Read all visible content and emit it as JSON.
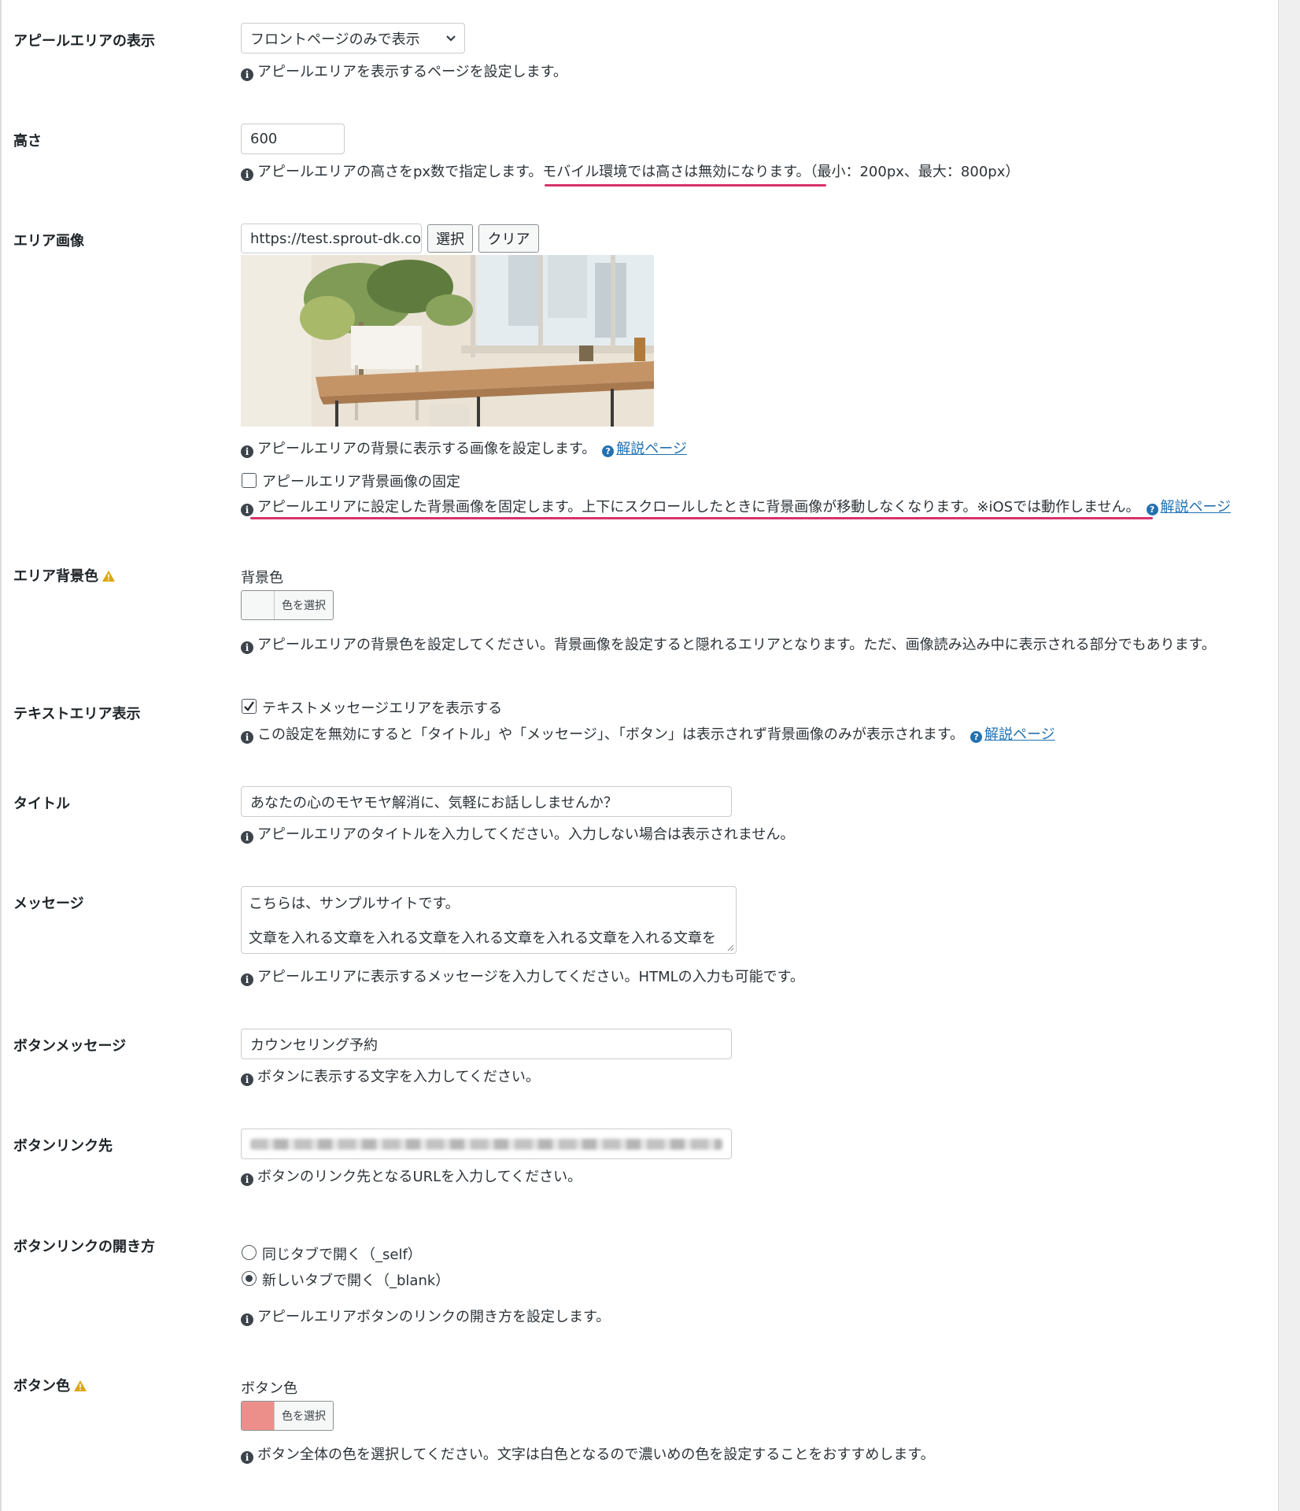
{
  "colors": {
    "accent": "#2271b1",
    "underline": "#d6336c",
    "button_color": "#ec8f8b",
    "warning": "#dba617"
  },
  "rows": {
    "display": {
      "label": "アピールエリアの表示",
      "select_value": "フロントページのみで表示",
      "desc": "アピールエリアを表示するページを設定します。"
    },
    "height": {
      "label": "高さ",
      "value": "600",
      "desc_a": "アピールエリアの高さをpx数で指定します。",
      "desc_b": "モバイル環境では高さは無効になります。",
      "desc_c": "（最小：200px、最大：800px）"
    },
    "image": {
      "label": "エリア画像",
      "url_value": "https://test.sprout-dk.co",
      "select_button": "選択",
      "clear_button": "クリア",
      "desc": "アピールエリアの背景に表示する画像を設定します。",
      "help_link": "解説ページ",
      "fixed_label": "アピールエリア背景画像の固定",
      "fixed_desc": "アピールエリアに設定した背景画像を固定します。上下にスクロールしたときに背景画像が移動しなくなります。※iOSでは動作しません。",
      "fixed_help_link": "解説ページ"
    },
    "bgcolor": {
      "label": "エリア背景色",
      "sub_label": "背景色",
      "picker_label": "色を選択",
      "desc": "アピールエリアの背景色を設定してください。背景画像を設定すると隠れるエリアとなります。ただ、画像読み込み中に表示される部分でもあります。"
    },
    "textarea_display": {
      "label": "テキストエリア表示",
      "checkbox_label": "テキストメッセージエリアを表示する",
      "desc": "この設定を無効にすると「タイトル」や「メッセージ」、「ボタン」は表示されず背景画像のみが表示されます。",
      "help_link": "解説ページ"
    },
    "title": {
      "label": "タイトル",
      "value": "あなたの心のモヤモヤ解消に、気軽にお話ししませんか？",
      "desc": "アピールエリアのタイトルを入力してください。入力しない場合は表示されません。"
    },
    "message": {
      "label": "メッセージ",
      "line1": "こちらは、サンプルサイトです。",
      "line2": "文章を入れる文章を入れる文章を入れる文章を入れる文章を入れる文章を",
      "desc": "アピールエリアに表示するメッセージを入力してください。HTMLの入力も可能です。"
    },
    "button_message": {
      "label": "ボタンメッセージ",
      "value": "カウンセリング予約",
      "desc": "ボタンに表示する文字を入力してください。"
    },
    "button_link": {
      "label": "ボタンリンク先",
      "desc": "ボタンのリンク先となるURLを入力してください。"
    },
    "button_target": {
      "label": "ボタンリンクの開き方",
      "option_self": "同じタブで開く（_self）",
      "option_blank": "新しいタブで開く（_blank）",
      "desc": "アピールエリアボタンのリンクの開き方を設定します。"
    },
    "button_color": {
      "label": "ボタン色",
      "sub_label": "ボタン色",
      "picker_label": "色を選択",
      "desc": "ボタン全体の色を選択してください。文字は白色となるので濃いめの色を設定することをおすすめします。"
    }
  }
}
